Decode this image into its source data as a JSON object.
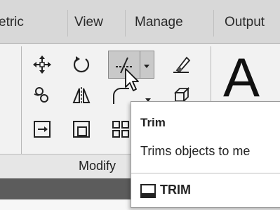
{
  "ribbon": {
    "tabs": [
      {
        "label": "etric"
      },
      {
        "label": "View"
      },
      {
        "label": "Manage"
      },
      {
        "label": "Output"
      }
    ]
  },
  "modify_panel": {
    "title": "Modify",
    "tools": [
      {
        "name": "move",
        "icon": "move-icon"
      },
      {
        "name": "rotate",
        "icon": "rotate-icon"
      },
      {
        "name": "trim",
        "icon": "trim-icon",
        "active": true
      },
      {
        "name": "erase",
        "icon": "erase-icon"
      },
      {
        "name": "copy",
        "icon": "copy-icon"
      },
      {
        "name": "mirror",
        "icon": "mirror-icon"
      },
      {
        "name": "fillet",
        "icon": "fillet-icon"
      },
      {
        "name": "explode",
        "icon": "explode-icon"
      },
      {
        "name": "stretch",
        "icon": "stretch-icon"
      },
      {
        "name": "scale",
        "icon": "scale-icon"
      },
      {
        "name": "array",
        "icon": "array-icon"
      }
    ]
  },
  "annotation_panel": {
    "text_tool_glyph": "A"
  },
  "tooltip": {
    "title": "Trim",
    "description": "Trims objects to me",
    "command": "TRIM",
    "command_icon": "command-line-icon"
  },
  "colors": {
    "tab_bar": "#d8d8d8",
    "panel": "#f2f2f2",
    "status_bar": "#5c5c5c",
    "tool_highlight": "#c9c9c9"
  }
}
